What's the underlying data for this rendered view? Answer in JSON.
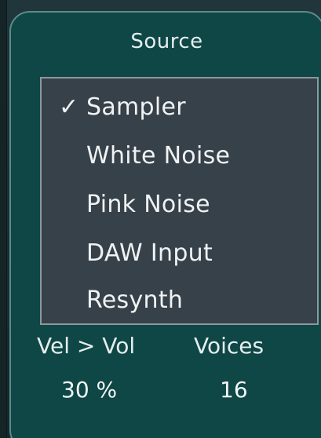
{
  "panel": {
    "title": "Source"
  },
  "source_menu": {
    "selected_marker": "✓",
    "items": [
      {
        "label": "Sampler",
        "selected": true
      },
      {
        "label": "White Noise",
        "selected": false
      },
      {
        "label": "Pink Noise",
        "selected": false
      },
      {
        "label": "DAW Input",
        "selected": false
      },
      {
        "label": "Resynth",
        "selected": false
      }
    ]
  },
  "params": {
    "vel_vol": {
      "label": "Vel > Vol",
      "value": "30 %"
    },
    "voices": {
      "label": "Voices",
      "value": "16"
    }
  },
  "colors": {
    "panel_bg": "#0f4646",
    "panel_border": "#5d8b8c",
    "menu_bg": "#36414a",
    "menu_border": "#8e979d",
    "text": "#e4eeee"
  }
}
